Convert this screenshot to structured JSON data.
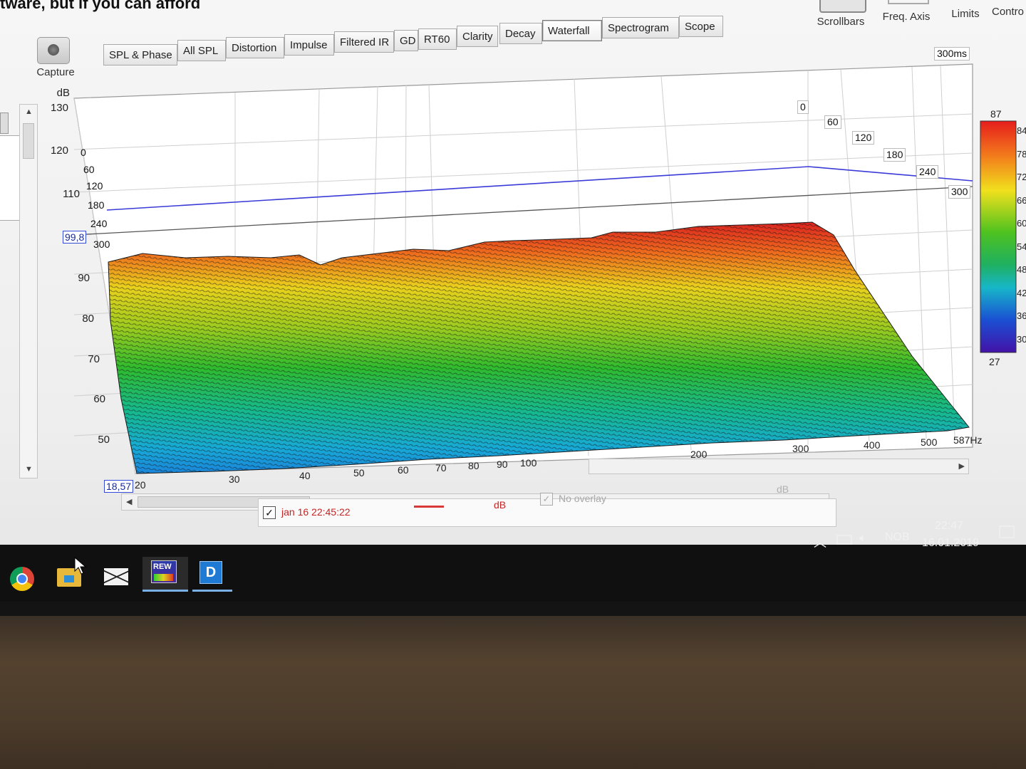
{
  "window": {
    "title_fragment": "tware, but if you can afford"
  },
  "toolbar": {
    "capture_label": "Capture",
    "right_buttons": [
      "Scrollbars",
      "Freq. Axis",
      "Limits",
      "Contro"
    ]
  },
  "tabs": [
    "SPL & Phase",
    "All SPL",
    "Distortion",
    "Impulse",
    "Filtered IR",
    "GD",
    "RT60",
    "Clarity",
    "Decay",
    "Waterfall",
    "Spectrogram",
    "Scope"
  ],
  "active_tab": "Waterfall",
  "plot": {
    "y_unit": "dB",
    "y_ticks": [
      "130",
      "120",
      "110",
      "90",
      "80",
      "70",
      "60",
      "50"
    ],
    "y_readout": "99,8",
    "x_ticks": [
      "30",
      "40",
      "50",
      "60",
      "70",
      "80",
      "90",
      "100",
      "200",
      "300",
      "400",
      "500",
      "587Hz"
    ],
    "x_readout": "18,57",
    "x_readout_suffix": "20",
    "time_window": "300ms",
    "time_labels_left": [
      "0",
      "60",
      "120",
      "180",
      "240",
      "300"
    ],
    "time_labels_right": [
      "0",
      "60",
      "120",
      "180",
      "240",
      "300"
    ],
    "colorscale_max": "87",
    "colorscale_min": "27",
    "colorscale_ticks": [
      "84",
      "78",
      "72",
      "66",
      "60",
      "54",
      "48",
      "42",
      "36",
      "30"
    ]
  },
  "legend": {
    "checked": true,
    "measurement": "jan 16 22:45:22",
    "unit": "dB",
    "overlay_label": "No overlay",
    "overlay_unit": "dB",
    "line_color": "#d83838"
  },
  "taskbar": {
    "apps": [
      "chrome-icon",
      "file-explorer-icon",
      "mail-icon",
      "rew-icon",
      "dirac-icon"
    ],
    "rew_label": "REW",
    "language": "NOB",
    "time": "22:47",
    "date": "16.01.2019"
  }
}
